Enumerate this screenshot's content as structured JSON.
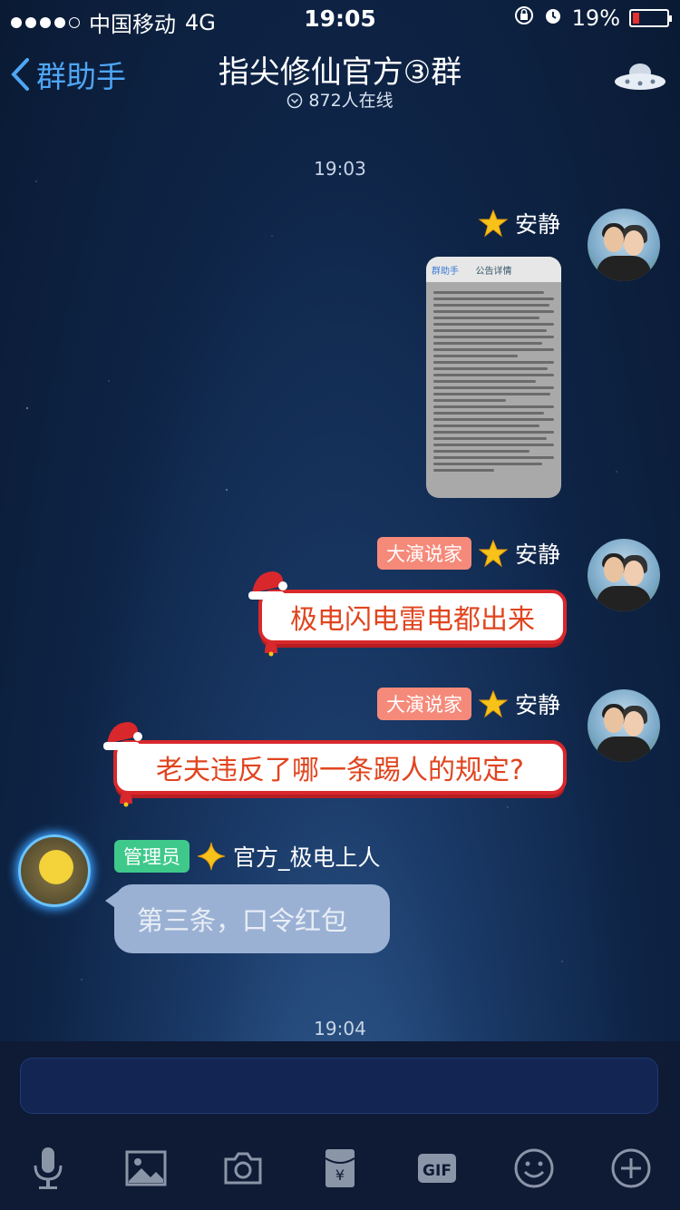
{
  "status_bar": {
    "carrier": "中国移动",
    "network": "4G",
    "time": "19:05",
    "battery": "19%"
  },
  "nav": {
    "back_label": "群助手",
    "title": "指尖修仙官方③群",
    "online": "872人在线"
  },
  "chat": {
    "time_top": "19:03",
    "time_bottom": "19:04",
    "messages": [
      {
        "sender": "安静",
        "type": "image"
      },
      {
        "sender": "安静",
        "title_badge": "大演说家",
        "text": "极电闪电雷电都出来"
      },
      {
        "sender": "安静",
        "title_badge": "大演说家",
        "text": "老夫违反了哪一条踢人的规定?"
      },
      {
        "sender": "官方_极电上人",
        "title_badge": "管理员",
        "text": "第三条，口令红包"
      }
    ],
    "screenshot": {
      "back": "群助手",
      "title": "公告详情"
    }
  },
  "toolbar": [
    "microphone-icon",
    "image-icon",
    "camera-icon",
    "red-packet-icon",
    "gif-icon",
    "emoji-icon",
    "plus-icon"
  ],
  "colors": {
    "accent": "#4fa6f5",
    "speaker_badge": "#f58a7a",
    "admin_badge": "#3ec98b",
    "xmas_red": "#d8282c"
  }
}
